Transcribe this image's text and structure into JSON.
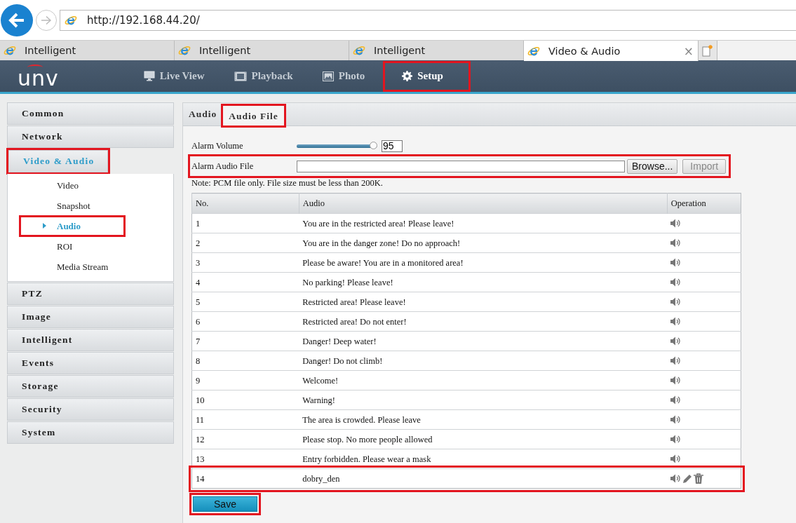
{
  "browser": {
    "address": "http://192.168.44.20/",
    "tabs": [
      {
        "title": "Intelligent",
        "selected": false
      },
      {
        "title": "Intelligent",
        "selected": false
      },
      {
        "title": "Intelligent",
        "selected": false
      },
      {
        "title": "Video & Audio",
        "selected": true,
        "close": "×"
      }
    ]
  },
  "app_nav": {
    "logo": "unv",
    "items": [
      {
        "label": "Live View",
        "selected": false,
        "highlighted": false
      },
      {
        "label": "Playback",
        "selected": false,
        "highlighted": false
      },
      {
        "label": "Photo",
        "selected": false,
        "highlighted": false
      },
      {
        "label": "Setup",
        "selected": true,
        "highlighted": true
      }
    ]
  },
  "sidebar": {
    "items": [
      {
        "label": "Common",
        "selected": false,
        "highlighted": false
      },
      {
        "label": "Network",
        "selected": false,
        "highlighted": false
      },
      {
        "label": "Video & Audio",
        "selected": true,
        "highlighted": true,
        "children": [
          {
            "label": "Video",
            "selected": false,
            "highlighted": false
          },
          {
            "label": "Snapshot",
            "selected": false,
            "highlighted": false
          },
          {
            "label": "Audio",
            "selected": true,
            "highlighted": true
          },
          {
            "label": "ROI",
            "selected": false,
            "highlighted": false
          },
          {
            "label": "Media Stream",
            "selected": false,
            "highlighted": false
          }
        ]
      },
      {
        "label": "PTZ",
        "selected": false,
        "highlighted": false
      },
      {
        "label": "Image",
        "selected": false,
        "highlighted": false
      },
      {
        "label": "Intelligent",
        "selected": false,
        "highlighted": false
      },
      {
        "label": "Events",
        "selected": false,
        "highlighted": false
      },
      {
        "label": "Storage",
        "selected": false,
        "highlighted": false
      },
      {
        "label": "Security",
        "selected": false,
        "highlighted": false
      },
      {
        "label": "System",
        "selected": false,
        "highlighted": false
      }
    ]
  },
  "content": {
    "tabs": [
      {
        "label": "Audio",
        "selected": false,
        "highlighted": false
      },
      {
        "label": "Audio File",
        "selected": true,
        "highlighted": true
      }
    ],
    "alarm_volume": {
      "label": "Alarm Volume",
      "level": 0.95,
      "value": "95"
    },
    "alarm_audio_file": {
      "label": "Alarm Audio File",
      "highlighted": true,
      "browse_button": "Browse...",
      "import_button": {
        "label": "Import",
        "disabled": true
      }
    },
    "note": "Note: PCM file only. File size must be less than 200K.",
    "table": {
      "columns": [
        "No.",
        "Audio",
        "Operation"
      ],
      "rows": [
        {
          "no": "1",
          "audio": "You are in the restricted area! Please leave!",
          "editable": false,
          "highlighted": false
        },
        {
          "no": "2",
          "audio": "You are in the danger zone! Do no approach!",
          "editable": false,
          "highlighted": false
        },
        {
          "no": "3",
          "audio": "Please be aware! You are in a monitored area!",
          "editable": false,
          "highlighted": false
        },
        {
          "no": "4",
          "audio": "No parking! Please leave!",
          "editable": false,
          "highlighted": false
        },
        {
          "no": "5",
          "audio": "Restricted area! Please leave!",
          "editable": false,
          "highlighted": false
        },
        {
          "no": "6",
          "audio": "Restricted area! Do not enter!",
          "editable": false,
          "highlighted": false
        },
        {
          "no": "7",
          "audio": "Danger! Deep water!",
          "editable": false,
          "highlighted": false
        },
        {
          "no": "8",
          "audio": "Danger! Do not climb!",
          "editable": false,
          "highlighted": false
        },
        {
          "no": "9",
          "audio": "Welcome!",
          "editable": false,
          "highlighted": false
        },
        {
          "no": "10",
          "audio": "Warning!",
          "editable": false,
          "highlighted": false
        },
        {
          "no": "11",
          "audio": "The area is crowded. Please leave",
          "editable": false,
          "highlighted": false
        },
        {
          "no": "12",
          "audio": "Please stop. No more people allowed",
          "editable": false,
          "highlighted": false
        },
        {
          "no": "13",
          "audio": "Entry forbidden. Please wear a mask",
          "editable": false,
          "highlighted": false
        },
        {
          "no": "14",
          "audio": "dobry_den",
          "editable": true,
          "highlighted": true
        }
      ]
    },
    "save_button": {
      "label": "Save",
      "highlighted": true
    }
  }
}
